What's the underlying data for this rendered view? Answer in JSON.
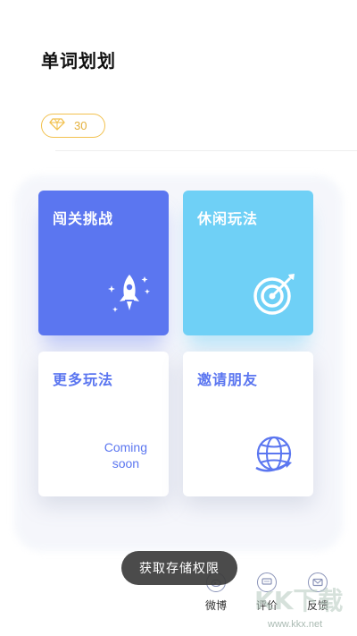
{
  "header": {
    "title": "单词划划"
  },
  "gems": {
    "count": "30",
    "icon": "diamond-icon",
    "color": "#f2c14e"
  },
  "cards": [
    {
      "title": "闯关挑战",
      "icon": "rocket-icon",
      "color": "#5b76f0"
    },
    {
      "title": "休闲玩法",
      "icon": "target-icon",
      "color": "#6fd0f6"
    },
    {
      "title": "更多玩法",
      "subtitle_line1": "Coming",
      "subtitle_line2": "soon"
    },
    {
      "title": "邀请朋友",
      "icon": "globe-icon"
    }
  ],
  "share": [
    {
      "label": "微博",
      "icon": "weibo-icon"
    },
    {
      "label": "评价",
      "icon": "comment-icon"
    },
    {
      "label": "反馈",
      "icon": "mail-icon"
    }
  ],
  "toast": {
    "text": "获取存储权限"
  },
  "watermark": {
    "text": "KK下载",
    "url": "www.kkx.net"
  }
}
